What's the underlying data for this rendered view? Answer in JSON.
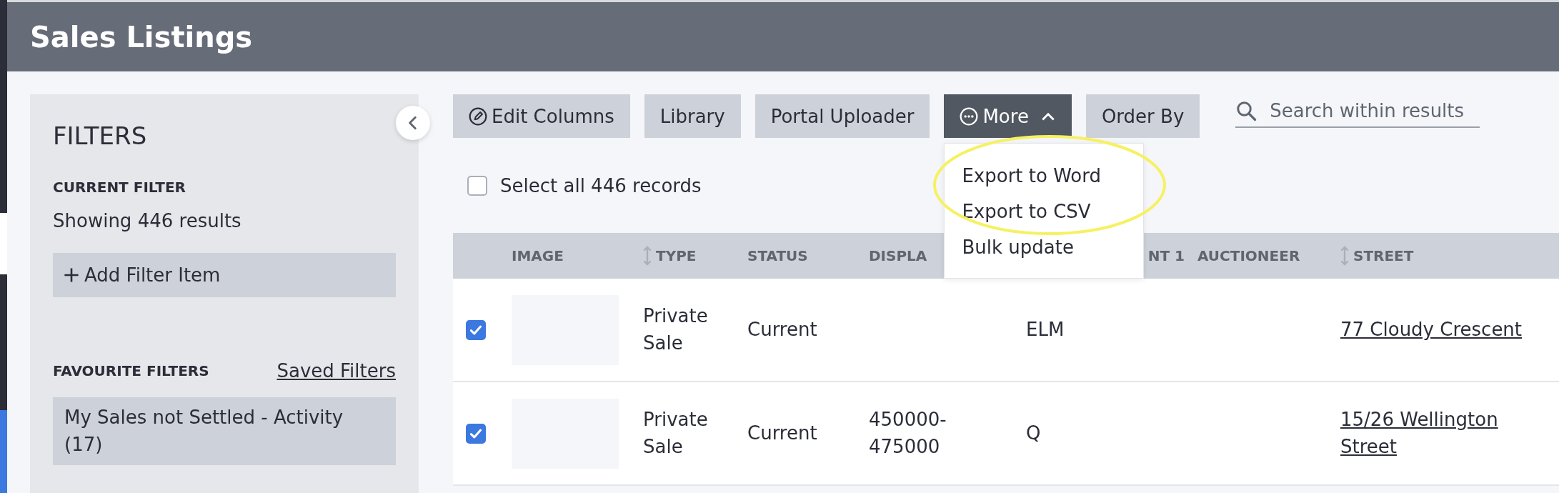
{
  "header": {
    "title": "Sales Listings"
  },
  "filters": {
    "title": "FILTERS",
    "current_heading": "CURRENT FILTER",
    "summary": "Showing 446 results",
    "add_button": "Add Filter Item",
    "favourites_heading": "FAVOURITE FILTERS",
    "saved_link": "Saved Filters",
    "favourites": [
      {
        "label": "My Sales not Settled - Activity (17)"
      }
    ]
  },
  "toolbar": {
    "buttons": [
      {
        "label": "Edit Columns",
        "kind": "edit"
      },
      {
        "label": "Library",
        "kind": "plain"
      },
      {
        "label": "Portal Uploader",
        "kind": "plain"
      },
      {
        "label": "More",
        "kind": "menu",
        "expanded": true
      },
      {
        "label": "Order By",
        "kind": "plain"
      }
    ],
    "menu_items": [
      {
        "label": "Export to Word"
      },
      {
        "label": "Export to CSV"
      },
      {
        "label": "Bulk update"
      }
    ],
    "search": {
      "placeholder": "Search within results"
    }
  },
  "select_all": {
    "label": "Select all 446 records",
    "checked": false
  },
  "table": {
    "columns": [
      {
        "label": "IMAGE",
        "sortable": false
      },
      {
        "label": "TYPE",
        "sortable": true
      },
      {
        "label": "STATUS",
        "sortable": false
      },
      {
        "label": "DISPLA",
        "sortable": false
      },
      {
        "label": "NT 1",
        "sortable": false
      },
      {
        "label": "AUCTIONEER",
        "sortable": false
      },
      {
        "label": "STREET",
        "sortable": true
      }
    ],
    "rows": [
      {
        "checked": true,
        "type": "Private Sale",
        "status": "Current",
        "column_5": "ELM",
        "street": "77 Cloudy Crescent"
      },
      {
        "checked": true,
        "type": "Private Sale",
        "status": "Current",
        "column_4": "450000-475000",
        "column_5": "Q",
        "street": "15/26 Wellington Street"
      }
    ]
  }
}
